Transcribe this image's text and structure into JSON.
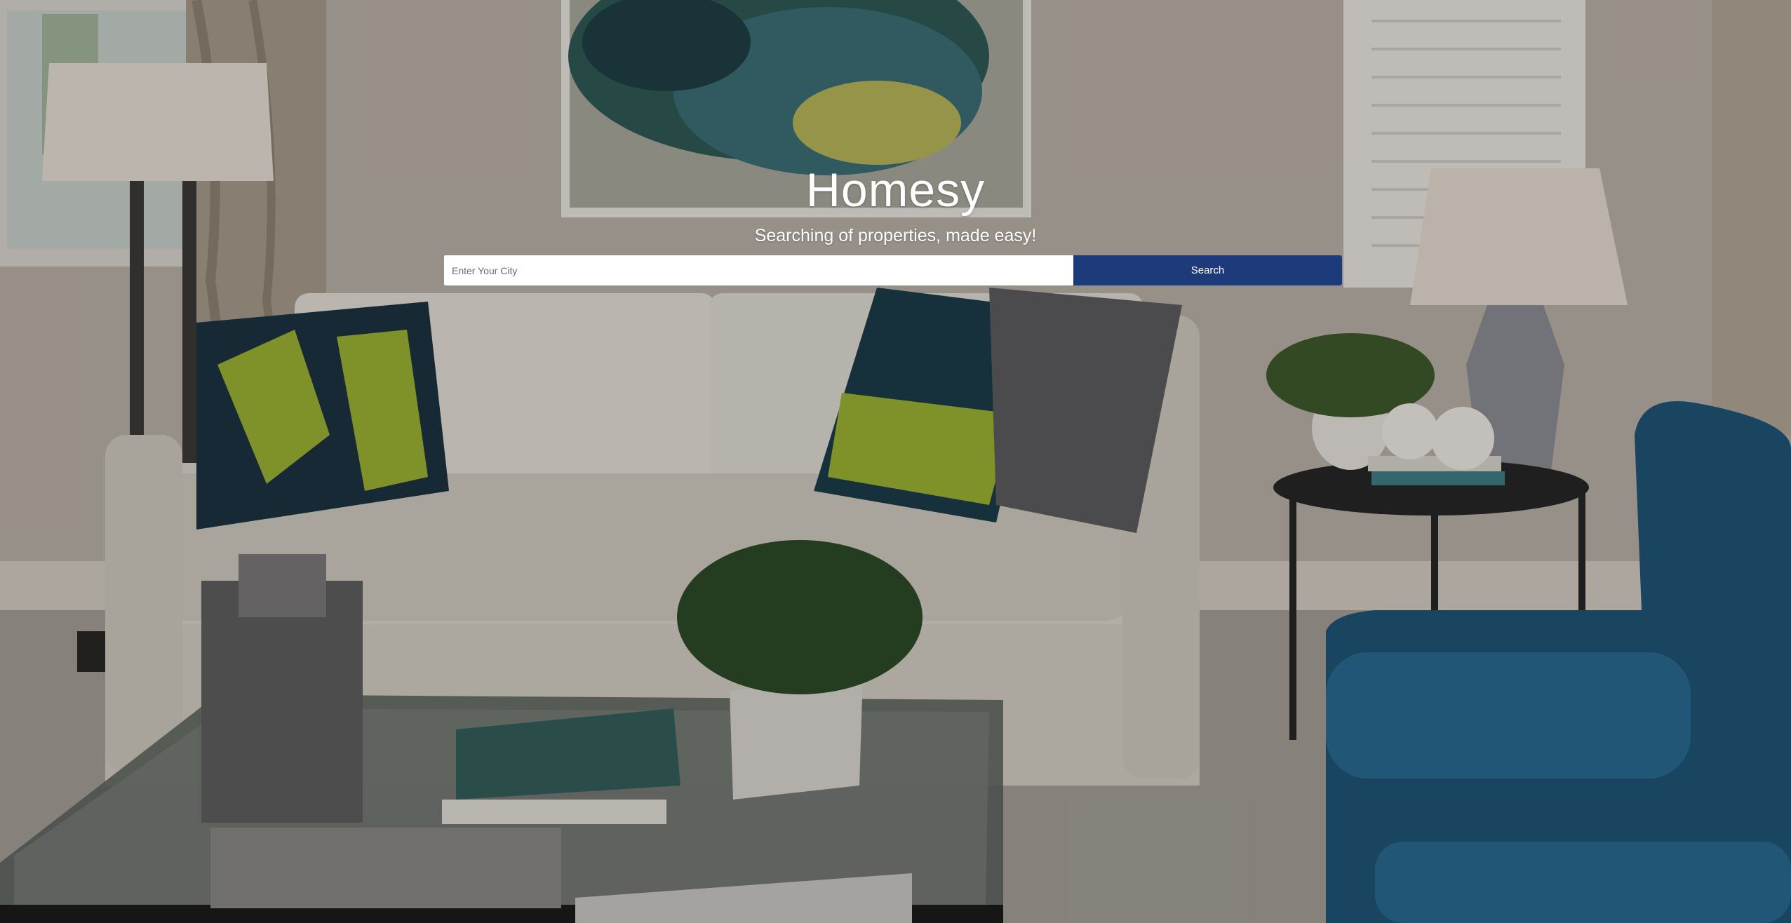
{
  "hero": {
    "title": "Homesy",
    "subtitle": "Searching of properties, made easy!"
  },
  "search": {
    "placeholder": "Enter Your City",
    "value": "",
    "button_label": "Search"
  },
  "colors": {
    "accent": "#1d3a7a",
    "heading_text": "#ffffff"
  }
}
